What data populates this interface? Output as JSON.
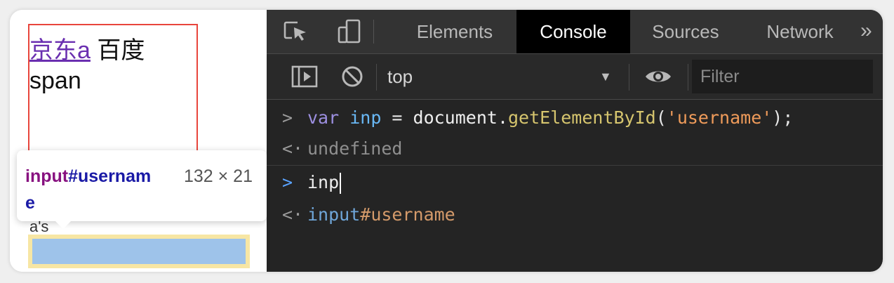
{
  "page": {
    "link_text": "京东a",
    "text_baidu": "百度",
    "text_span": "span",
    "tooltip": {
      "tag": "input",
      "id": "#username",
      "size": "132 × 21"
    },
    "under_tooltip_text": "a's"
  },
  "devtools": {
    "tabs": [
      {
        "label": "Elements",
        "active": false
      },
      {
        "label": "Console",
        "active": true
      },
      {
        "label": "Sources",
        "active": false
      },
      {
        "label": "Network",
        "active": false
      }
    ],
    "more_tabs": "»",
    "tab_icons": [
      "inspect-element-icon",
      "device-toolbar-icon"
    ],
    "toolbar": {
      "context": "top",
      "context_arrow": "▼",
      "filter_placeholder": "Filter",
      "icons": [
        "sidebar-toggle-icon",
        "clear-console-icon",
        "eye-icon"
      ]
    },
    "console": {
      "input_prompt": ">",
      "output_prompt": "<·",
      "entries": [
        {
          "type": "input",
          "parts": [
            "var",
            " ",
            "inp",
            " = ",
            "document.",
            "getElementById",
            "(",
            "'username'",
            ");"
          ]
        },
        {
          "type": "output",
          "text": "undefined"
        },
        {
          "type": "input",
          "text": "inp",
          "active": true
        },
        {
          "type": "output",
          "tag": "input",
          "id": "#username"
        }
      ]
    }
  },
  "colors": {
    "devtools_bg": "#242424",
    "active_tab_bg": "#000000",
    "highlight_red": "#e8453c",
    "link_visited": "#6a2fb0"
  }
}
